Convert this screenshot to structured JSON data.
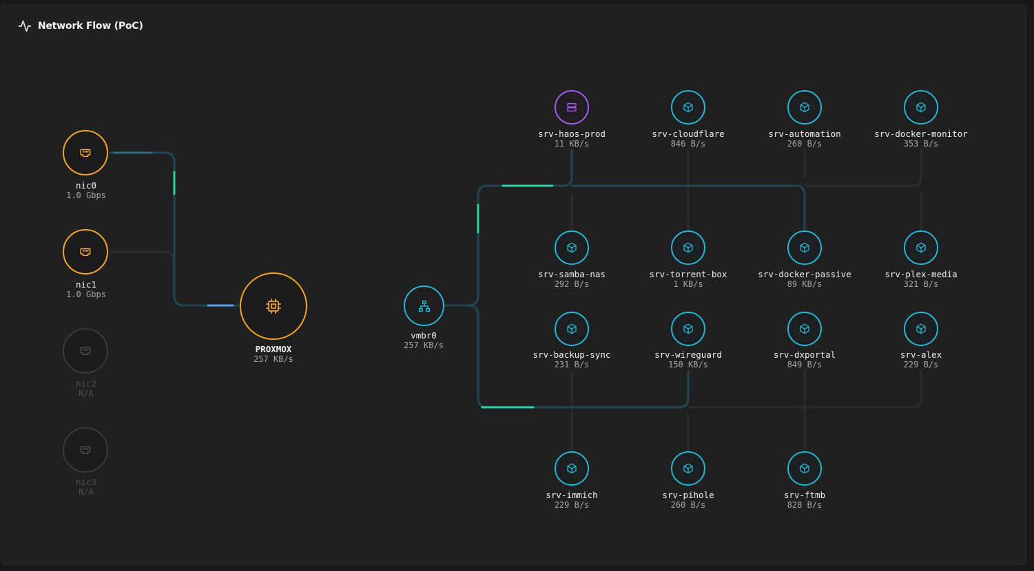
{
  "header": {
    "title": "Network Flow (PoC)",
    "icon": "activity-icon"
  },
  "colors": {
    "nic_active": "#f5a524",
    "nic_inactive": "#3a3a3a",
    "container": "#22b8d6",
    "vm": "#a85bf2",
    "flow_teal": "#2dd4a8",
    "flow_blue": "#3b82f6",
    "link_idle": "#2b2b2b",
    "link_active": "#1f4a5a"
  },
  "nics": [
    {
      "name": "nic0",
      "rate": "1.0 Gbps",
      "active": true,
      "icon": "ethernet-port-icon"
    },
    {
      "name": "nic1",
      "rate": "1.0 Gbps",
      "active": true,
      "icon": "ethernet-port-icon"
    },
    {
      "name": "nic2",
      "rate": "N/A",
      "active": false,
      "icon": "ethernet-port-icon"
    },
    {
      "name": "nic3",
      "rate": "N/A",
      "active": false,
      "icon": "ethernet-port-icon"
    }
  ],
  "host": {
    "name": "PROXMOX",
    "rate": "257 KB/s",
    "icon": "cpu-chip-icon"
  },
  "bridge": {
    "name": "vmbr0",
    "rate": "257 KB/s",
    "icon": "network-topology-icon"
  },
  "guests": [
    {
      "name": "srv-haos-prod",
      "rate": "11 KB/s",
      "kind": "vm",
      "icon": "server-icon"
    },
    {
      "name": "srv-cloudflare",
      "rate": "846 B/s",
      "kind": "ct",
      "icon": "container-box-icon"
    },
    {
      "name": "srv-automation",
      "rate": "260 B/s",
      "kind": "ct",
      "icon": "container-box-icon"
    },
    {
      "name": "srv-docker-monitor",
      "rate": "353 B/s",
      "kind": "ct",
      "icon": "container-box-icon"
    },
    {
      "name": "srv-samba-nas",
      "rate": "292 B/s",
      "kind": "ct",
      "icon": "container-box-icon"
    },
    {
      "name": "srv-torrent-box",
      "rate": "1 KB/s",
      "kind": "ct",
      "icon": "container-box-icon"
    },
    {
      "name": "srv-docker-passive",
      "rate": "89 KB/s",
      "kind": "ct",
      "icon": "container-box-icon"
    },
    {
      "name": "srv-plex-media",
      "rate": "321 B/s",
      "kind": "ct",
      "icon": "container-box-icon"
    },
    {
      "name": "srv-backup-sync",
      "rate": "231 B/s",
      "kind": "ct",
      "icon": "container-box-icon"
    },
    {
      "name": "srv-wireguard",
      "rate": "150 KB/s",
      "kind": "ct",
      "icon": "container-box-icon"
    },
    {
      "name": "srv-dxportal",
      "rate": "849 B/s",
      "kind": "ct",
      "icon": "container-box-icon"
    },
    {
      "name": "srv-alex",
      "rate": "229 B/s",
      "kind": "ct",
      "icon": "container-box-icon"
    },
    {
      "name": "srv-immich",
      "rate": "229 B/s",
      "kind": "ct",
      "icon": "container-box-icon"
    },
    {
      "name": "srv-pihole",
      "rate": "260 B/s",
      "kind": "ct",
      "icon": "container-box-icon"
    },
    {
      "name": "srv-ftmb",
      "rate": "828 B/s",
      "kind": "ct",
      "icon": "container-box-icon"
    }
  ]
}
